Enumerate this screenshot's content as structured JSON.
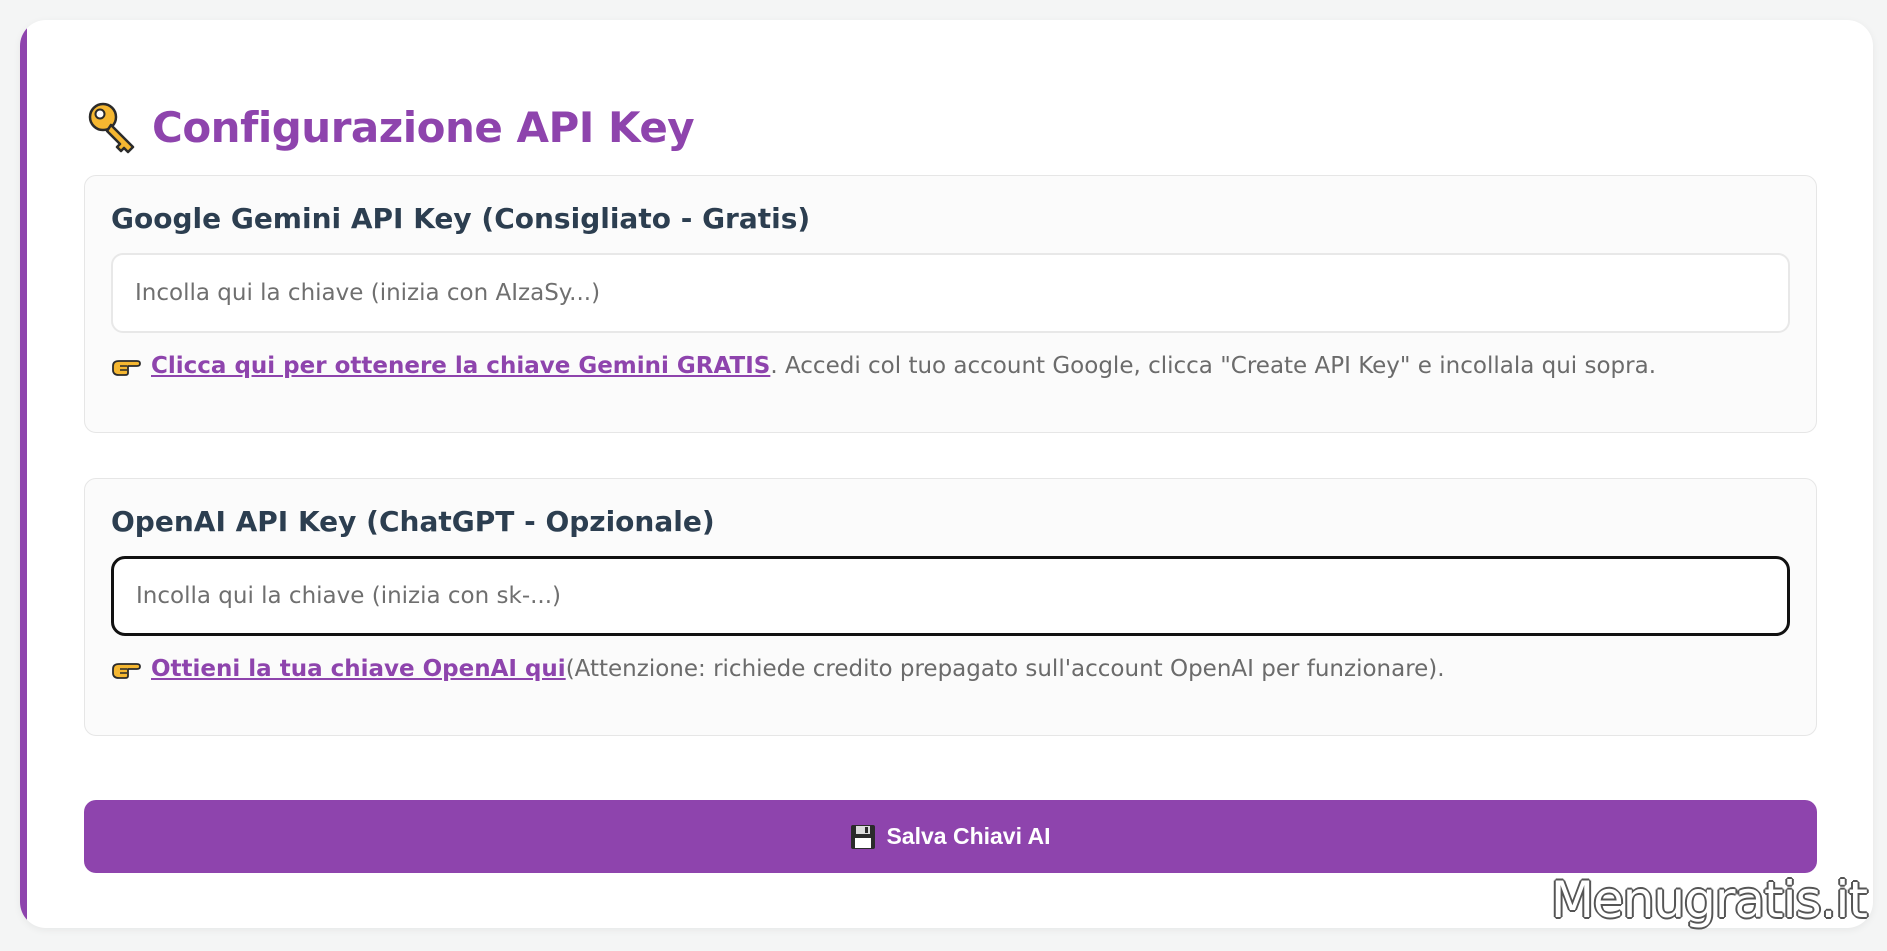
{
  "header": {
    "title": "Configurazione API Key",
    "icon": "key-icon"
  },
  "gemini": {
    "label": "Google Gemini API Key (Consigliato - Gratis)",
    "input_value": "",
    "input_placeholder": "Incolla qui la chiave (inizia con AIzaSy...)",
    "link_text": "Clicca qui per ottenere la chiave Gemini GRATIS",
    "help_text": ". Accedi col tuo account Google, clicca \"Create API Key\" e incollala qui sopra."
  },
  "openai": {
    "label": "OpenAI API Key (ChatGPT - Opzionale)",
    "input_value": "",
    "input_placeholder": "Incolla qui la chiave (inizia con sk-...)",
    "link_text": "Ottieni la tua chiave OpenAI qui",
    "help_text": " (Attenzione: richiede credito prepagato sull'account OpenAI per funzionare)."
  },
  "save_button": {
    "label": "Salva Chiavi AI",
    "icon": "floppy-disk-icon"
  },
  "watermark": "Menugratis.it",
  "colors": {
    "accent": "#8e44ad",
    "heading": "#2c3e50",
    "muted_text": "#6b6b6b"
  }
}
